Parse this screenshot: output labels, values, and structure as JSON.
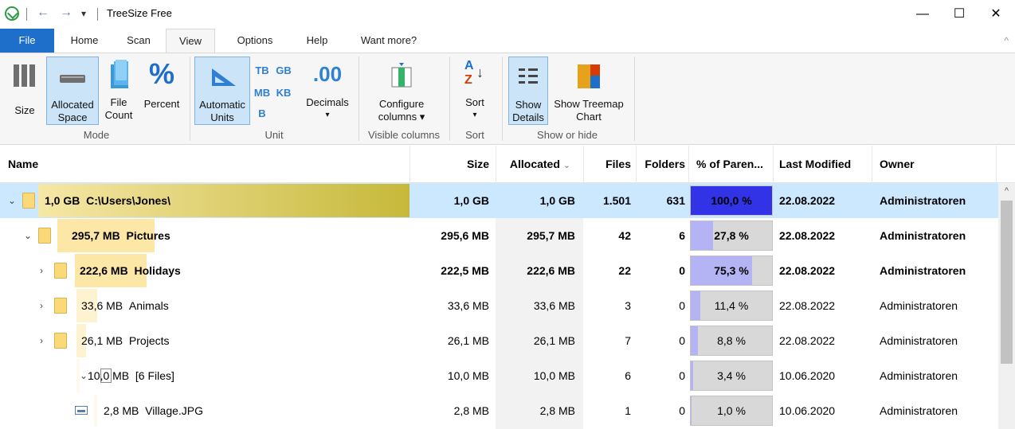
{
  "window": {
    "title": "TreeSize Free",
    "qa_back": "←",
    "qa_forward": "→",
    "qa_menu": "▾",
    "minimize": "—",
    "maximize": "☐",
    "close": "✕"
  },
  "tabs": [
    "File",
    "Home",
    "Scan",
    "View",
    "Options",
    "Help",
    "Want more?"
  ],
  "ribbon": {
    "mode": {
      "label": "Mode",
      "size": "Size",
      "allocated_line1": "Allocated",
      "allocated_line2": "Space",
      "filecount_line1": "File",
      "filecount_line2": "Count",
      "percent": "Percent",
      "percent_glyph": "%"
    },
    "unit": {
      "label": "Unit",
      "auto_line1": "Automatic",
      "auto_line2": "Units",
      "tb": "TB",
      "gb": "GB",
      "mb": "MB",
      "kb": "KB",
      "b": "B",
      "decimals_glyph": ".00",
      "decimals": "Decimals",
      "decimals_arrow": "▾"
    },
    "visible_columns": {
      "label": "Visible columns",
      "configure_line1": "Configure",
      "configure_line2": "columns ▾"
    },
    "sort": {
      "label": "Sort",
      "sort": "Sort",
      "sort_arrow": "▾",
      "sort_glyph_a": "A",
      "sort_glyph_z": "Z"
    },
    "show_or_hide": {
      "label": "Show or hide",
      "show_line1": "Show",
      "show_line2": "Details",
      "treemap_line1": "Show Treemap",
      "treemap_line2": "Chart"
    }
  },
  "columns": {
    "name": "Name",
    "size": "Size",
    "allocated": "Allocated",
    "allocated_sort": "⌄",
    "files": "Files",
    "folders": "Folders",
    "percent": "% of Paren...",
    "modified": "Last Modified",
    "owner": "Owner"
  },
  "rows": [
    {
      "chev": "⌄",
      "label_size": "1,0 GB",
      "name": "C:\\Users\\Jones\\",
      "size": "1,0 GB",
      "allocated": "1,0 GB",
      "files": "1.501",
      "folders": "631",
      "percent": "100,0 %",
      "percent_value": 100.0,
      "modified": "22.08.2022",
      "owner": "Administratoren"
    },
    {
      "chev": "⌄",
      "label_size": "295,7 MB",
      "name": "Pictures",
      "size": "295,6 MB",
      "allocated": "295,7 MB",
      "files": "42",
      "folders": "6",
      "percent": "27,8 %",
      "percent_value": 27.8,
      "modified": "22.08.2022",
      "owner": "Administratoren"
    },
    {
      "chev": "›",
      "label_size": "222,6 MB",
      "name": "Holidays",
      "size": "222,5 MB",
      "allocated": "222,6 MB",
      "files": "22",
      "folders": "0",
      "percent": "75,3 %",
      "percent_value": 75.3,
      "modified": "22.08.2022",
      "owner": "Administratoren"
    },
    {
      "chev": "›",
      "label_size": "33,6 MB",
      "name": "Animals",
      "size": "33,6 MB",
      "allocated": "33,6 MB",
      "files": "3",
      "folders": "0",
      "percent": "11,4 %",
      "percent_value": 11.4,
      "modified": "22.08.2022",
      "owner": "Administratoren"
    },
    {
      "chev": "›",
      "label_size": "26,1 MB",
      "name": "Projects",
      "size": "26,1 MB",
      "allocated": "26,1 MB",
      "files": "7",
      "folders": "0",
      "percent": "8,8 %",
      "percent_value": 8.8,
      "modified": "22.08.2022",
      "owner": "Administratoren"
    },
    {
      "chev": "⌄",
      "label_size": "10,0 MB",
      "name": "[6 Files]",
      "size": "10,0 MB",
      "allocated": "10,0 MB",
      "files": "6",
      "folders": "0",
      "percent": "3,4 %",
      "percent_value": 3.4,
      "modified": "10.06.2020",
      "owner": "Administratoren"
    },
    {
      "chev": "",
      "label_size": "2,8 MB",
      "name": "Village.JPG",
      "size": "2,8 MB",
      "allocated": "2,8 MB",
      "files": "1",
      "folders": "0",
      "percent": "1,0 %",
      "percent_value": 1.0,
      "modified": "10.06.2020",
      "owner": "Administratoren"
    }
  ],
  "scrollbar": {
    "up": "^"
  },
  "colors": {
    "file_tab": "#1e6fc9",
    "selection": "#cce8ff",
    "folder": "#f9d978",
    "percent_full": "#3232e6",
    "percent_partial": "#b4b4f4"
  }
}
